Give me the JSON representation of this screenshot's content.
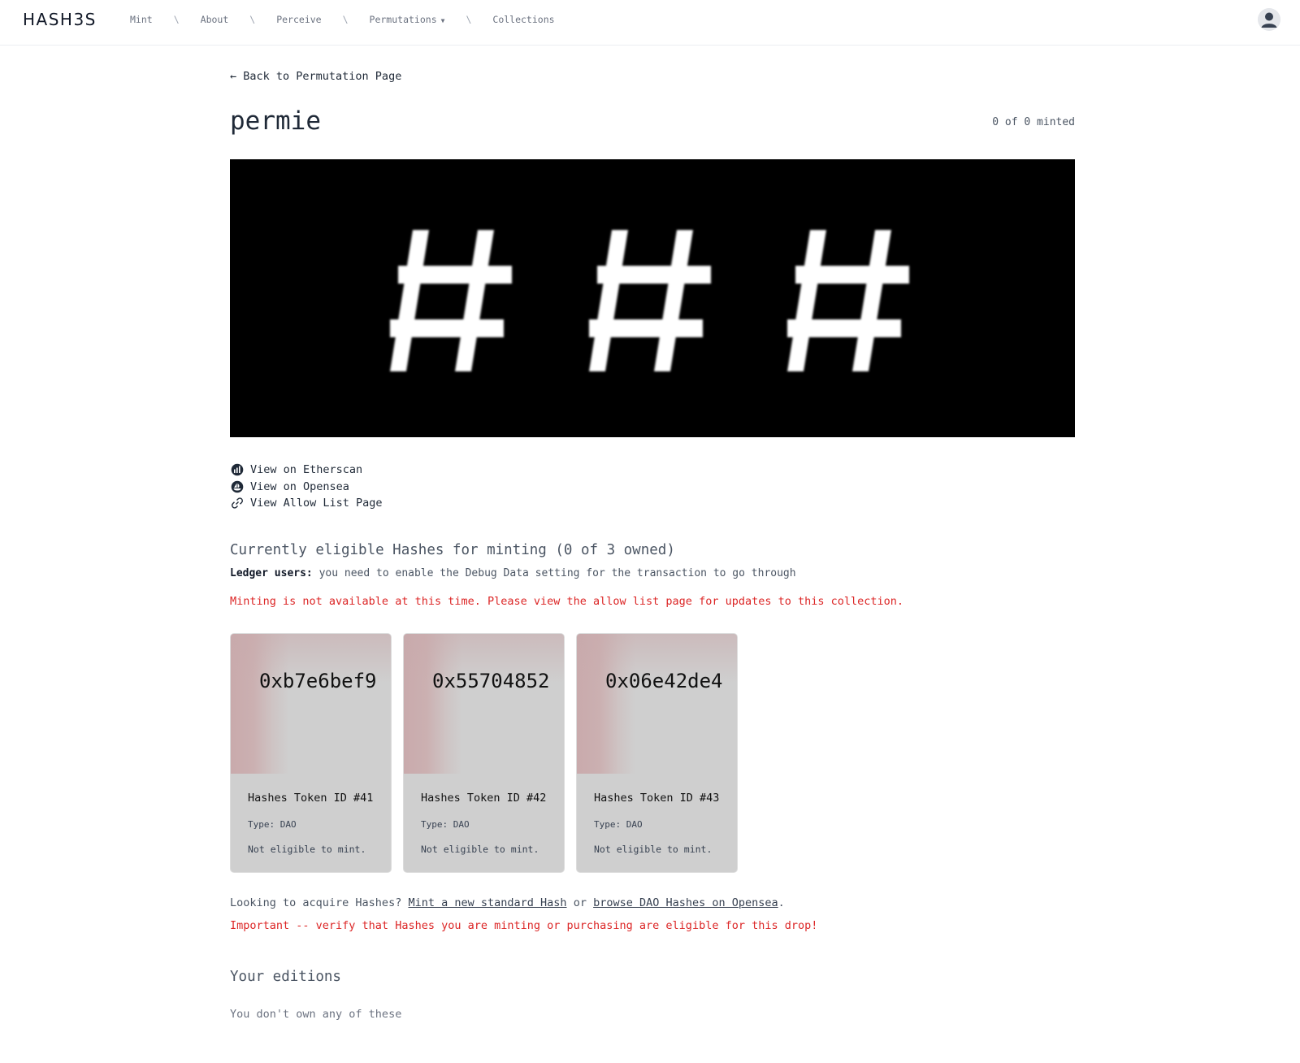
{
  "header": {
    "logo": "HASH3S",
    "nav": [
      {
        "label": "Mint"
      },
      {
        "label": "About"
      },
      {
        "label": "Perceive"
      },
      {
        "label": "Permutations",
        "has_dropdown": true
      },
      {
        "label": "Collections"
      }
    ],
    "separator": "\\",
    "avatar_icon": "user-avatar-icon"
  },
  "main": {
    "back_link": "← Back to Permutation Page",
    "title": "permie",
    "minted_status": "0 of 0 minted",
    "hero": {
      "glyphs": "###",
      "background": "#000000",
      "foreground": "#ffffff"
    },
    "links": [
      {
        "icon": "etherscan-icon",
        "label": "View on Etherscan"
      },
      {
        "icon": "opensea-icon",
        "label": "View on Opensea"
      },
      {
        "icon": "link-icon",
        "label": "View Allow List Page"
      }
    ],
    "eligible_title": "Currently eligible Hashes for minting (0 of 3 owned)",
    "ledger_label": "Ledger users:",
    "ledger_text": "you need to enable the Debug Data setting for the transaction to go through",
    "minting_notice": "Minting is not available at this time. Please view the allow list page for updates to this collection.",
    "cards": [
      {
        "hash": "0xb7e6bef9",
        "name": "Hashes Token ID #41",
        "type": "Type: DAO",
        "status": "Not eligible to mint."
      },
      {
        "hash": "0x55704852",
        "name": "Hashes Token ID #42",
        "type": "Type: DAO",
        "status": "Not eligible to mint."
      },
      {
        "hash": "0x06e42de4",
        "name": "Hashes Token ID #43",
        "type": "Type: DAO",
        "status": "Not eligible to mint."
      }
    ],
    "acquire": {
      "prefix": "Looking to acquire Hashes?",
      "mint_link": "Mint a new standard Hash",
      "or": "or",
      "browse_link": "browse DAO Hashes on Opensea",
      "suffix": "."
    },
    "important": "Important -- verify that Hashes you are minting or purchasing are eligible for this drop!",
    "editions_title": "Your editions",
    "editions_empty": "You don't own any of these"
  },
  "colors": {
    "accent_red": "#dc2626",
    "text": "#1f2937",
    "muted": "#4b5563",
    "card_bg": "#cfcfcf"
  }
}
